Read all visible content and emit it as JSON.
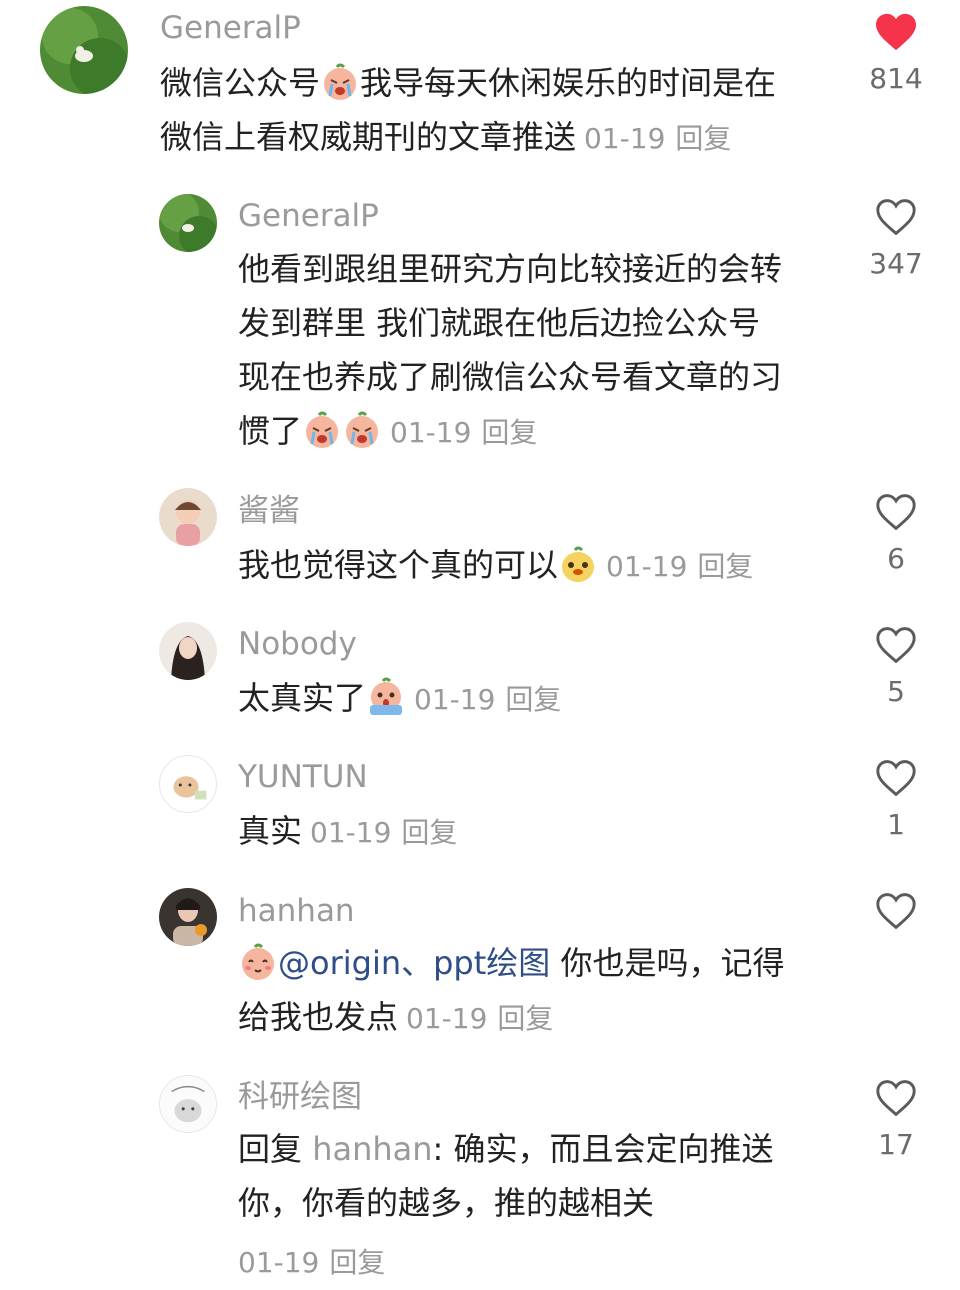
{
  "colors": {
    "liked_heart": "#f5334a",
    "heart_outline": "#5a5a5a",
    "username": "#9a9a9a",
    "mention": "#2f4e87",
    "text": "#222222"
  },
  "comments": [
    {
      "username": "GeneralP",
      "lines": [
        "微信公众号",
        "我导每天休闲娱乐的时间是在",
        "微信上看权威期刊的文章推送"
      ],
      "date": "01-19",
      "reply_label": "回复",
      "like_count": "814",
      "liked": true,
      "icons": [
        "crying-emoji-icon",
        "heart-filled-icon"
      ]
    },
    {
      "username": "GeneralP",
      "lines": [
        "他看到跟组里研究方向比较接近的会转",
        "发到群里 我们就跟在他后边捡公众号",
        "现在也养成了刷微信公众号看文章的习",
        "惯了"
      ],
      "date": "01-19",
      "reply_label": "回复",
      "like_count": "347",
      "icons": [
        "crying-emoji-icon",
        "heart-outline-icon"
      ]
    },
    {
      "username": "酱酱",
      "lines": [
        "我也觉得这个真的可以"
      ],
      "date": "01-19",
      "reply_label": "回复",
      "like_count": "6",
      "icons": [
        "smile-emoji-icon",
        "heart-outline-icon"
      ]
    },
    {
      "username": "Nobody",
      "lines": [
        "太真实了"
      ],
      "date": "01-19",
      "reply_label": "回复",
      "like_count": "5",
      "icons": [
        "shocked-emoji-icon",
        "heart-outline-icon"
      ]
    },
    {
      "username": "YUNTUN",
      "lines": [
        "真实"
      ],
      "date": "01-19",
      "reply_label": "回复",
      "like_count": "1",
      "icons": [
        "heart-outline-icon"
      ]
    },
    {
      "username": "hanhan",
      "mention": "@origin、ppt绘图",
      "lines": [
        " 你也是吗，记得",
        "给我也发点"
      ],
      "date": "01-19",
      "reply_label": "回复",
      "like_count": "",
      "icons": [
        "blush-emoji-icon",
        "heart-outline-icon"
      ]
    },
    {
      "username": "科研绘图",
      "reply_prefix": "回复",
      "reply_to": "hanhan",
      "lines": [
        ": 确实，而且会定向推送",
        "你，你看的越多，推的越相关"
      ],
      "date": "01-19",
      "reply_label": "回复",
      "like_count": "17",
      "icons": [
        "heart-outline-icon"
      ]
    }
  ]
}
